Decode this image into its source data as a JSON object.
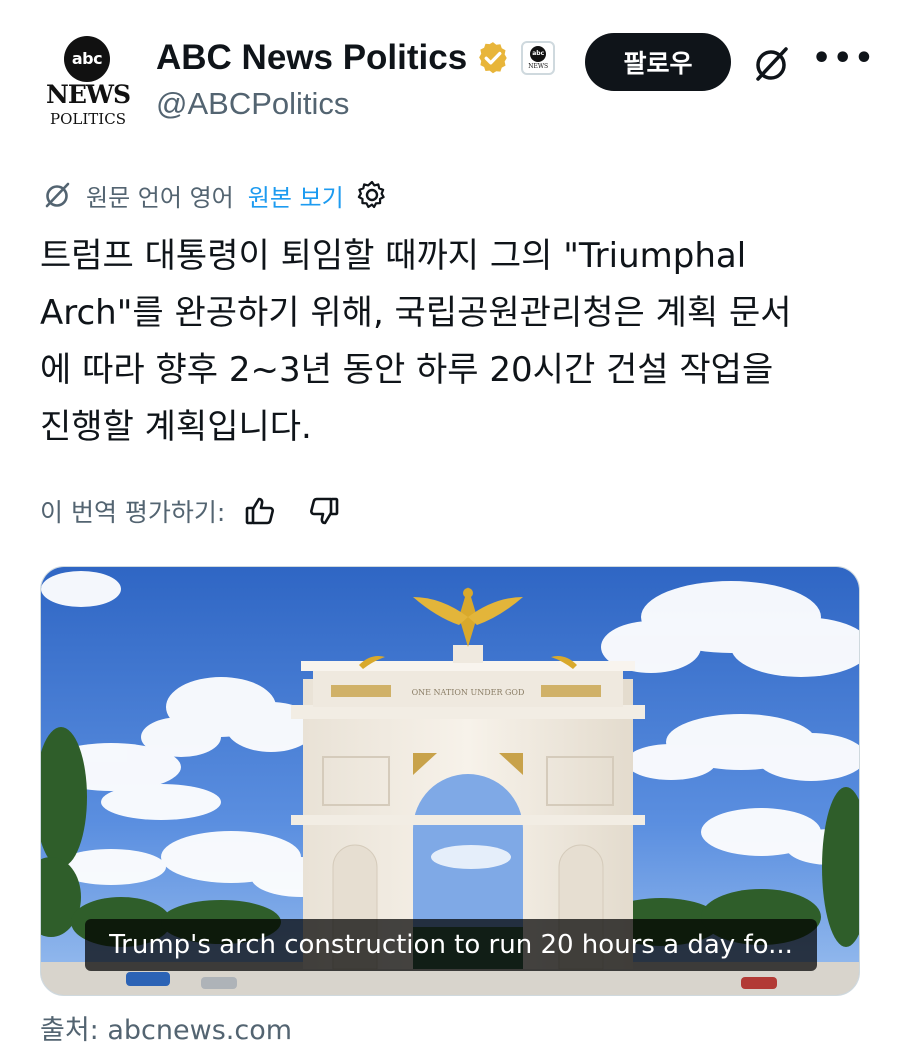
{
  "account": {
    "display_name": "ABC News Politics",
    "handle": "@ABCPolitics",
    "avatar_logo": "abc",
    "avatar_news": "NEWS",
    "avatar_politics": "POLITICS",
    "badge_logo": "abc",
    "badge_news": "NEWS",
    "verified_color": "#e8b53a"
  },
  "actions": {
    "follow_label": "팔로우",
    "more_label": "•••"
  },
  "translation": {
    "note": "원문 언어 영어",
    "show_original": "원본 보기",
    "link_color": "#1d9bf0"
  },
  "post": {
    "text": "트럼프 대통령이 퇴임할 때까지 그의 \"Triumphal\nArch\"를 완공하기 위해, 국립공원관리청은 계획 문서\n에 따라 향후 2~3년 동안 하루 20시간 건설 작업을\n진행할 계획입니다."
  },
  "rating": {
    "label": "이 번역 평가하기:"
  },
  "media": {
    "caption": "Trump's arch construction to run 20 hours a day fo...",
    "arch_inscription": "ONE NATION UNDER GOD"
  },
  "source": {
    "label": "출처: abcnews.com"
  }
}
